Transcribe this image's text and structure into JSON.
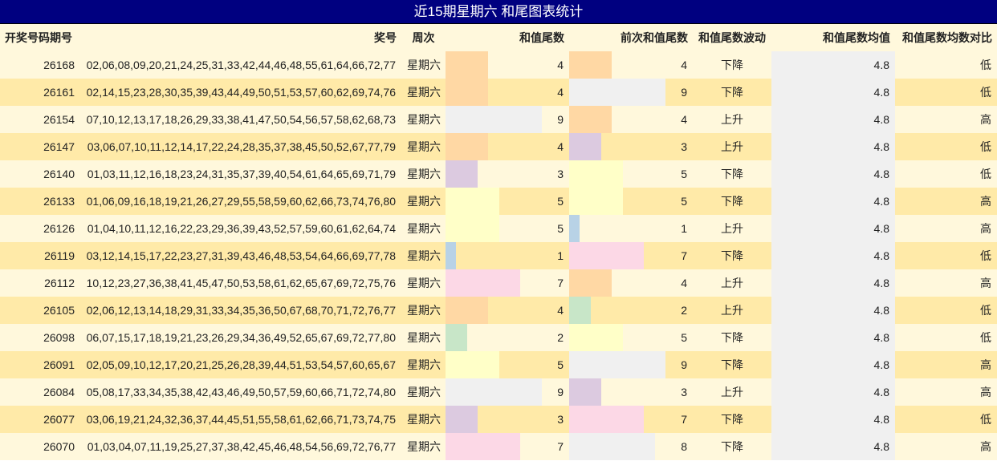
{
  "title": "近15期星期六 和尾图表统计",
  "headers": {
    "period": "开奖号码期号",
    "numbers": "奖号",
    "weekday": "周次",
    "tail": "和值尾数",
    "prev_tail": "前次和值尾数",
    "trend": "和值尾数波动",
    "avg": "和值尾数均值",
    "compare": "和值尾数均数对比"
  },
  "tail_colors": {
    "1": "#b8d2e6",
    "2": "#c8e6c8",
    "3": "#dccae0",
    "4": "#ffd8a4",
    "5": "#ffffc8",
    "7": "#fcd8e6",
    "8": "#f0f0f0",
    "9": "#f0f0f0"
  },
  "rows": [
    {
      "period": "26168",
      "numbers": "02,06,08,09,20,21,24,25,31,33,42,44,46,48,55,61,64,66,72,77",
      "weekday": "星期六",
      "tail": "4",
      "prev_tail": "4",
      "trend": "下降",
      "avg": "4.8",
      "compare": "低"
    },
    {
      "period": "26161",
      "numbers": "02,14,15,23,28,30,35,39,43,44,49,50,51,53,57,60,62,69,74,76",
      "weekday": "星期六",
      "tail": "4",
      "prev_tail": "9",
      "trend": "下降",
      "avg": "4.8",
      "compare": "低"
    },
    {
      "period": "26154",
      "numbers": "07,10,12,13,17,18,26,29,33,38,41,47,50,54,56,57,58,62,68,73",
      "weekday": "星期六",
      "tail": "9",
      "prev_tail": "4",
      "trend": "上升",
      "avg": "4.8",
      "compare": "高"
    },
    {
      "period": "26147",
      "numbers": "03,06,07,10,11,12,14,17,22,24,28,35,37,38,45,50,52,67,77,79",
      "weekday": "星期六",
      "tail": "4",
      "prev_tail": "3",
      "trend": "上升",
      "avg": "4.8",
      "compare": "低"
    },
    {
      "period": "26140",
      "numbers": "01,03,11,12,16,18,23,24,31,35,37,39,40,54,61,64,65,69,71,79",
      "weekday": "星期六",
      "tail": "3",
      "prev_tail": "5",
      "trend": "下降",
      "avg": "4.8",
      "compare": "低"
    },
    {
      "period": "26133",
      "numbers": "01,06,09,16,18,19,21,26,27,29,55,58,59,60,62,66,73,74,76,80",
      "weekday": "星期六",
      "tail": "5",
      "prev_tail": "5",
      "trend": "下降",
      "avg": "4.8",
      "compare": "高"
    },
    {
      "period": "26126",
      "numbers": "01,04,10,11,12,16,22,23,29,36,39,43,52,57,59,60,61,62,64,74",
      "weekday": "星期六",
      "tail": "5",
      "prev_tail": "1",
      "trend": "上升",
      "avg": "4.8",
      "compare": "高"
    },
    {
      "period": "26119",
      "numbers": "03,12,14,15,17,22,23,27,31,39,43,46,48,53,54,64,66,69,77,78",
      "weekday": "星期六",
      "tail": "1",
      "prev_tail": "7",
      "trend": "下降",
      "avg": "4.8",
      "compare": "低"
    },
    {
      "period": "26112",
      "numbers": "10,12,23,27,36,38,41,45,47,50,53,58,61,62,65,67,69,72,75,76",
      "weekday": "星期六",
      "tail": "7",
      "prev_tail": "4",
      "trend": "上升",
      "avg": "4.8",
      "compare": "高"
    },
    {
      "period": "26105",
      "numbers": "02,06,12,13,14,18,29,31,33,34,35,36,50,67,68,70,71,72,76,77",
      "weekday": "星期六",
      "tail": "4",
      "prev_tail": "2",
      "trend": "上升",
      "avg": "4.8",
      "compare": "低"
    },
    {
      "period": "26098",
      "numbers": "06,07,15,17,18,19,21,23,26,29,34,36,49,52,65,67,69,72,77,80",
      "weekday": "星期六",
      "tail": "2",
      "prev_tail": "5",
      "trend": "下降",
      "avg": "4.8",
      "compare": "低"
    },
    {
      "period": "26091",
      "numbers": "02,05,09,10,12,17,20,21,25,26,28,39,44,51,53,54,57,60,65,67",
      "weekday": "星期六",
      "tail": "5",
      "prev_tail": "9",
      "trend": "下降",
      "avg": "4.8",
      "compare": "高"
    },
    {
      "period": "26084",
      "numbers": "05,08,17,33,34,35,38,42,43,46,49,50,57,59,60,66,71,72,74,80",
      "weekday": "星期六",
      "tail": "9",
      "prev_tail": "3",
      "trend": "上升",
      "avg": "4.8",
      "compare": "高"
    },
    {
      "period": "26077",
      "numbers": "03,06,19,21,24,32,36,37,44,45,51,55,58,61,62,66,71,73,74,75",
      "weekday": "星期六",
      "tail": "3",
      "prev_tail": "7",
      "trend": "下降",
      "avg": "4.8",
      "compare": "低"
    },
    {
      "period": "26070",
      "numbers": "01,03,04,07,11,19,25,27,37,38,42,45,46,48,54,56,69,72,76,77",
      "weekday": "星期六",
      "tail": "7",
      "prev_tail": "8",
      "trend": "下降",
      "avg": "4.8",
      "compare": "高"
    }
  ]
}
